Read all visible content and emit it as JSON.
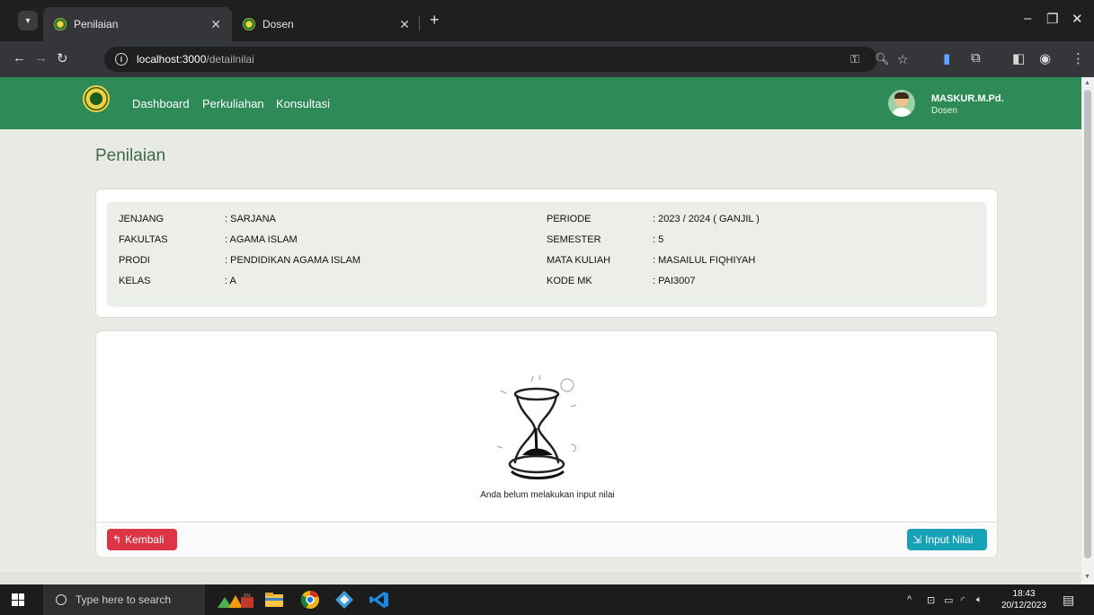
{
  "browser": {
    "tabs": [
      {
        "title": "Penilaian",
        "active": true
      },
      {
        "title": "Dosen",
        "active": false
      }
    ],
    "new_tab": "+",
    "url_host": "localhost:3000",
    "url_path": "/detailnilai"
  },
  "navbar": {
    "links": [
      "Dashboard",
      "Perkuliahan",
      "Konsultasi"
    ],
    "user_name": "MASKUR.M.Pd.",
    "user_role": "Dosen"
  },
  "page": {
    "title": "Penilaian"
  },
  "info": {
    "left": [
      {
        "label": "JENJANG",
        "value": ": SARJANA"
      },
      {
        "label": "FAKULTAS",
        "value": ": AGAMA ISLAM"
      },
      {
        "label": "PRODI",
        "value": ": PENDIDIKAN AGAMA ISLAM"
      },
      {
        "label": "KELAS",
        "value": ": A"
      }
    ],
    "right": [
      {
        "label": "PERIODE",
        "value": ": 2023 / 2024 ( GANJIL )"
      },
      {
        "label": "SEMESTER",
        "value": ": 5"
      },
      {
        "label": "MATA KULIAH",
        "value": ": MASAILUL FIQHIYAH"
      },
      {
        "label": "KODE MK",
        "value": ": PAI3007"
      }
    ]
  },
  "result": {
    "empty_message": "Anda belum melakukan input nilai",
    "back_label": "Kembali",
    "input_label": "Input Nilai"
  },
  "taskbar": {
    "search_placeholder": "Type here to search",
    "time": "18:43",
    "date": "20/12/2023"
  },
  "colors": {
    "navbar": "#2e8b57",
    "back_button": "#dc3545",
    "input_button": "#17a2b8",
    "page_title": "#3d6b4a"
  }
}
